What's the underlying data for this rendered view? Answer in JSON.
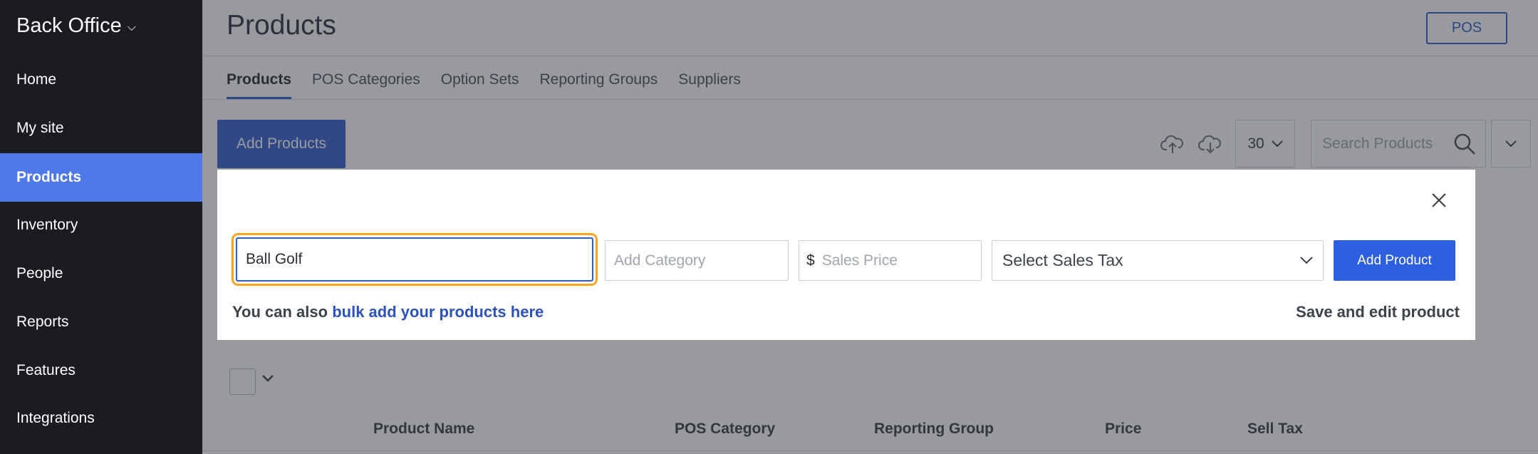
{
  "sidebar": {
    "brand": "Back Office",
    "items": [
      {
        "label": "Home"
      },
      {
        "label": "My site"
      },
      {
        "label": "Products"
      },
      {
        "label": "Inventory"
      },
      {
        "label": "People"
      },
      {
        "label": "Reports"
      },
      {
        "label": "Features"
      },
      {
        "label": "Integrations"
      }
    ],
    "active": "Products"
  },
  "header": {
    "title": "Products",
    "pos_button": "POS"
  },
  "tabs": [
    {
      "label": "Products",
      "active": true
    },
    {
      "label": "POS Categories"
    },
    {
      "label": "Option Sets"
    },
    {
      "label": "Reporting Groups"
    },
    {
      "label": "Suppliers"
    }
  ],
  "toolbar": {
    "add_products_label": "Add Products",
    "upload_icon": "cloud-upload-icon",
    "download_icon": "cloud-download-icon",
    "per_page": "30",
    "search_placeholder": "Search Products"
  },
  "table": {
    "columns": [
      "Product Name",
      "POS Category",
      "Reporting Group",
      "Price",
      "Sell Tax"
    ]
  },
  "modal": {
    "name_value": "Ball Golf",
    "category_placeholder": "Add Category",
    "currency_symbol": "$",
    "price_placeholder": "Sales Price",
    "tax_select": "Select Sales Tax",
    "add_product_label": "Add Product",
    "helper_prefix": "You can also",
    "helper_link": "bulk add your products here",
    "save_edit_label": "Save and edit product"
  },
  "colors": {
    "sidebar_bg": "#1a1c22",
    "accent": "#2d60e0",
    "focus_ring": "#f5a623"
  }
}
